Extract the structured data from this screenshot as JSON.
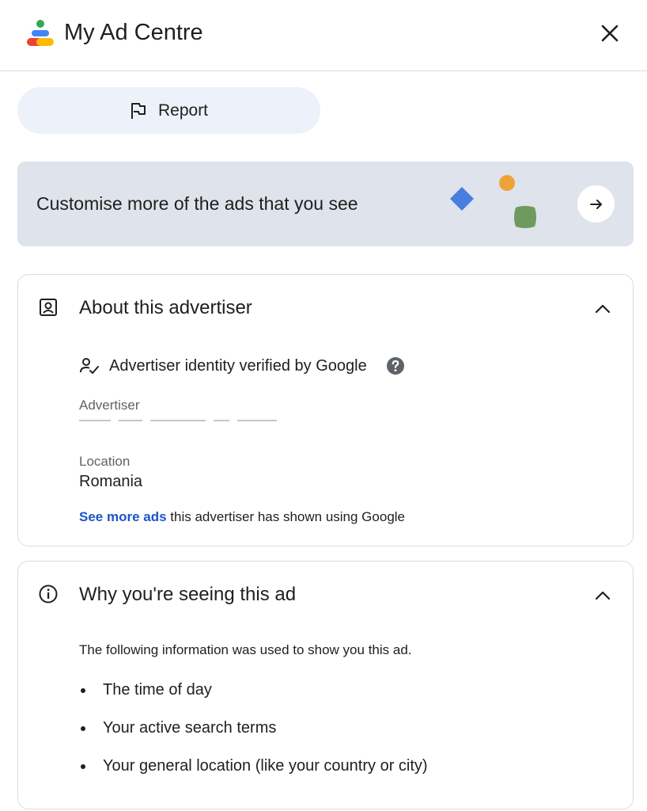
{
  "header": {
    "title": "My Ad Centre",
    "logo_icon": "my-ad-centre-logo",
    "close_icon": "close-icon"
  },
  "report": {
    "label": "Report",
    "icon": "flag-icon"
  },
  "customise": {
    "text": "Customise more of the ads that you see",
    "arrow_icon": "arrow-right-icon"
  },
  "advertiser_section": {
    "title": "About this advertiser",
    "icon": "person-badge-icon",
    "verified_text": "Advertiser identity verified by Google",
    "advertiser_label": "Advertiser",
    "location_label": "Location",
    "location_value": "Romania",
    "see_more_link": "See more ads",
    "see_more_rest": " this advertiser has shown using Google"
  },
  "why_section": {
    "title": "Why you're seeing this ad",
    "icon": "info-icon",
    "intro": "The following information was used to show you this ad.",
    "reasons": [
      "The time of day",
      "Your active search terms",
      "Your general location (like your country or city)"
    ]
  },
  "colors": {
    "link": "#1a56c9",
    "report_bg": "#edf2fa",
    "customise_bg": "#dfe3eb",
    "border": "#dadce0",
    "muted_text": "#5f6368"
  }
}
